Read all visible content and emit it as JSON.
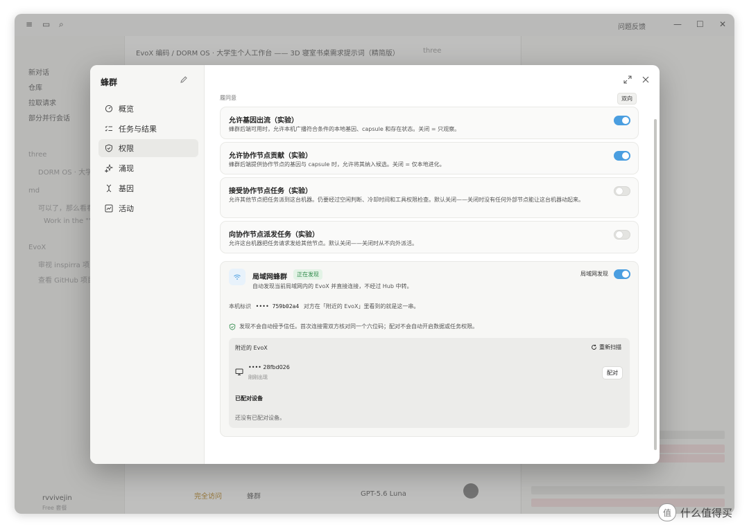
{
  "background_app": {
    "feedback": "问题反馈",
    "breadcrumb": "EvoX 编码 / DORM OS · 大学生个人工作台 —— 3D 寝室书桌需求提示词（精简版）",
    "repo_tag": "three",
    "sidebar_items": [
      "新对话",
      "仓库",
      "拉取请求",
      "部分并行会话",
      "three",
      "DORM OS · 大学...",
      "md",
      "可以了，那么看看",
      "Work in the \"\"...",
      "EvoX",
      "审视 inspirra 项目",
      "查看 GitHub 项目"
    ],
    "user_name": "rvvivejin",
    "user_plan": "Free 套餐",
    "composer_access": "完全访问",
    "composer_swarm": "蜂群",
    "composer_model": "GPT-5.6 Luna"
  },
  "modal": {
    "title": "蜂群",
    "nav": [
      {
        "label": "概览",
        "icon": "gauge-icon"
      },
      {
        "label": "任务与结果",
        "icon": "list-check-icon"
      },
      {
        "label": "权限",
        "icon": "shield-icon"
      },
      {
        "label": "涌现",
        "icon": "sparkle-icon"
      },
      {
        "label": "基因",
        "icon": "dna-icon"
      },
      {
        "label": "活动",
        "icon": "activity-icon"
      }
    ],
    "active_nav": "权限",
    "section_label": "履同意",
    "direction_badge": "双向",
    "settings": [
      {
        "title": "允许基因出流（实验）",
        "desc": "蜂群后端可用时，允许本机广播符合条件的本地基因、capsule 和存在状态。关闭 = 只观察。",
        "enabled": true
      },
      {
        "title": "允许协作节点贡献（实验）",
        "desc": "蜂群后端提供协作节点的基因与 capsule 时，允许将其纳入候选。关闭 = 仅本地进化。",
        "enabled": true
      },
      {
        "title": "接受协作节点任务（实验）",
        "desc": "允许其他节点把任务派到这台机器。仍要经过空闲判断、冷却时间和工具权限检查。默认关闭——关闭时没有任何外部节点能让这台机器动起来。",
        "enabled": false
      },
      {
        "title": "向协作节点派发任务（实验）",
        "desc": "允许这台机器把任务请求发给其他节点。默认关闭——关闭时从不向外派活。",
        "enabled": false
      }
    ],
    "lan": {
      "title": "局域网蜂群",
      "status": "正在发现",
      "subtitle": "自动发现当前局域网内的 EvoX 并直接连接，不经过 Hub 中转。",
      "toggle_label": "局域网发现",
      "enabled": true,
      "id_label": "本机标识",
      "id_value": "•••• 759b02a4",
      "id_hint": "对方在「附近的 EvoX」里看到的就是这一串。",
      "trust_note": "发现不会自动授予信任。首次连接需双方核对同一个六位码；配对不会自动开启数据或任务权限。",
      "nearby_title": "附近的 EvoX",
      "rescan_label": "重新扫描",
      "device_id": "•••• 28fbd026",
      "device_seen": "刚刚出现",
      "pair_label": "配对",
      "paired_title": "已配对设备",
      "paired_empty": "还没有已配对设备。"
    }
  },
  "watermark": "什么值得买",
  "colors": {
    "toggle_on": "#4a9ee0",
    "status_green": "#2f8a4a"
  }
}
